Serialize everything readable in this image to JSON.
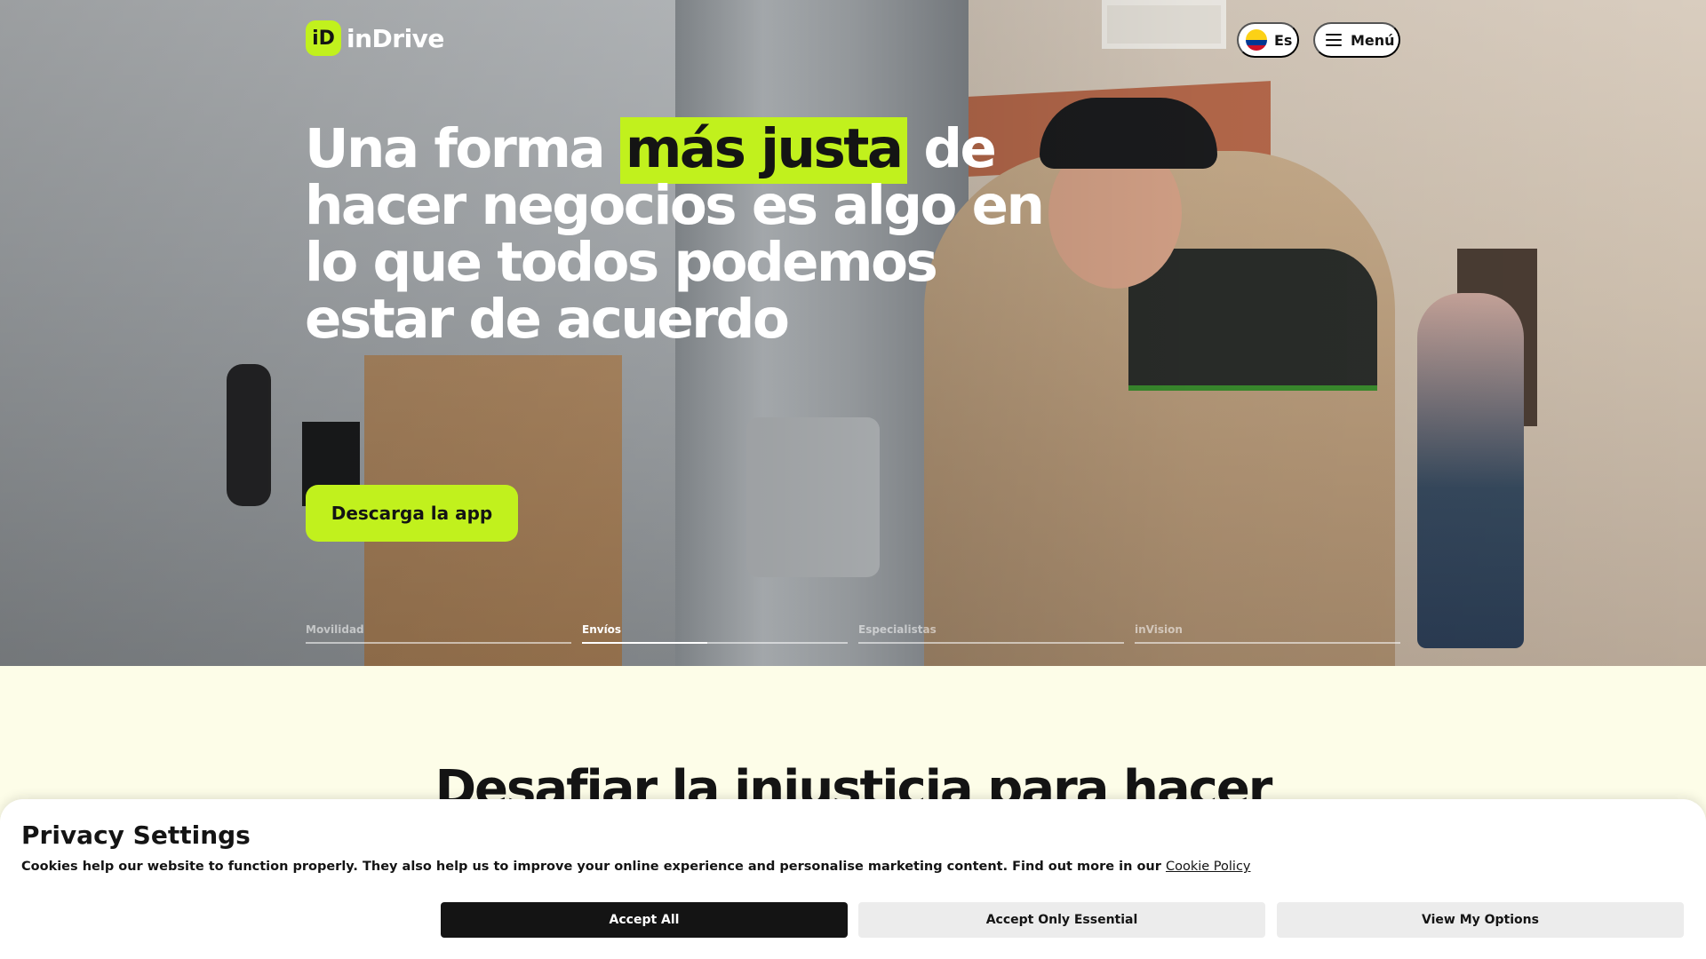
{
  "header": {
    "logo_mark": "iD",
    "logo_text": "inDrive",
    "language_label": "Es",
    "menu_label": "Menú"
  },
  "hero": {
    "headline_before": "Una forma ",
    "headline_highlight": "más justa",
    "headline_after": " de hacer negocios es algo en lo que todos podemos estar de acuerdo",
    "cta_label": "Descarga la app",
    "tabs": [
      {
        "label": "Movilidad",
        "active": false,
        "progress": 0
      },
      {
        "label": "Envíos",
        "active": true,
        "progress": 0.47
      },
      {
        "label": "Especialistas",
        "active": false,
        "progress": 0
      },
      {
        "label": "inVision",
        "active": false,
        "progress": 0
      }
    ]
  },
  "section": {
    "title": "Desafiar la injusticia para hacer"
  },
  "cookie_banner": {
    "title": "Privacy Settings",
    "text": "Cookies help our website to function properly. They also help us to improve your online experience and personalise marketing content. Find out more in our ",
    "link_label": "Cookie Policy",
    "accept_all_label": "Accept All",
    "accept_essential_label": "Accept Only Essential",
    "view_options_label": "View My Options"
  },
  "colors": {
    "accent": "#c1f11d",
    "text_dark": "#141414",
    "page_background": "#fdfde8"
  }
}
